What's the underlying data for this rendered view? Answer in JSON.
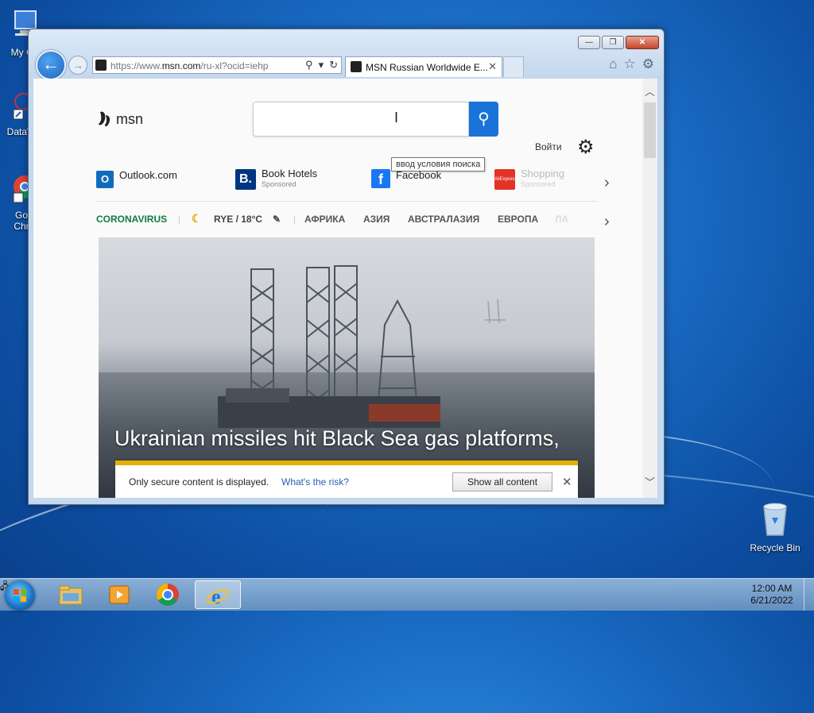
{
  "desktop": {
    "icons": [
      {
        "label": "My Co",
        "icon": "computer-icon"
      },
      {
        "label": "DataW",
        "icon": "datawave-shortcut-icon"
      },
      {
        "label": "Go\nChr",
        "icon": "chrome-shortcut-icon"
      },
      {
        "label": "Recycle Bin",
        "icon": "recycle-bin-icon"
      }
    ]
  },
  "browser": {
    "window_controls": {
      "minimize": "—",
      "restore": "❐",
      "close": "✕"
    },
    "address": {
      "url_prefix": "https://www.",
      "url_domain": "msn.com",
      "url_rest": "/ru-xl?ocid=iehp"
    },
    "tab": {
      "title": "MSN Russian Worldwide E...",
      "close": "✕"
    },
    "icons": [
      "home-icon",
      "favorites-star-icon",
      "tools-gear-icon"
    ]
  },
  "msn": {
    "logo_text": "msn",
    "search": {
      "placeholder": "",
      "tooltip": "ввод условия поиска"
    },
    "signin": "Войти",
    "quicklinks": [
      {
        "label": "Outlook.com",
        "sponsored": "",
        "icon": "outlook-icon",
        "color": "#0f6cbd"
      },
      {
        "label": "Book Hotels",
        "sponsored": "Sponsored",
        "icon": "booking-icon",
        "color": "#003580"
      },
      {
        "label": "Facebook",
        "sponsored": "",
        "icon": "facebook-icon",
        "color": "#1877f2"
      },
      {
        "label": "Shopping",
        "sponsored": "Sponsored",
        "icon": "aliexpress-icon",
        "color": "#e43225"
      }
    ],
    "nav": {
      "coronavirus": "CORONAVIRUS",
      "weather": "RYE / 18°C",
      "regions": [
        "АФРИКА",
        "АЗИЯ",
        "АВСТРАЛАЗИЯ",
        "ЕВРОПА",
        "ЛА"
      ]
    },
    "hero": {
      "headline": "Ukrainian missiles hit Black Sea gas platforms,"
    },
    "notification": {
      "message": "Only secure content is displayed.",
      "risk_link": "What's the risk?",
      "button": "Show all content"
    }
  },
  "taskbar": {
    "items": [
      "windows-explorer-icon",
      "media-player-icon",
      "chrome-icon",
      "internet-explorer-icon"
    ],
    "time": "12:00 AM",
    "date": "6/21/2022"
  },
  "colors": {
    "accent_blue": "#1a73d9",
    "coronavirus_green": "#107c41",
    "warning_yellow": "#e0b100"
  }
}
